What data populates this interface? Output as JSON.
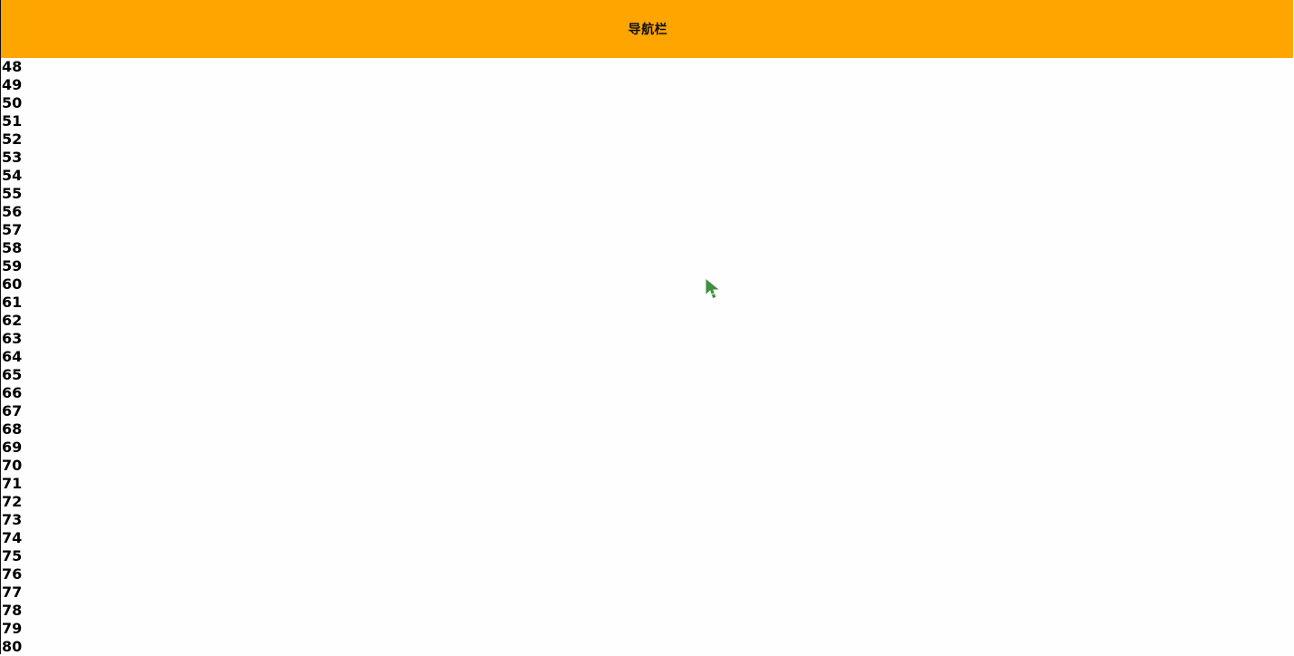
{
  "navbar": {
    "title": "导航栏",
    "background_color": "#ffa500"
  },
  "list": {
    "items": [
      "48",
      "49",
      "50",
      "51",
      "52",
      "53",
      "54",
      "55",
      "56",
      "57",
      "58",
      "59",
      "60",
      "61",
      "62",
      "63",
      "64",
      "65",
      "66",
      "67",
      "68",
      "69",
      "70",
      "71",
      "72",
      "73",
      "74",
      "75",
      "76",
      "77",
      "78",
      "79",
      "80"
    ]
  },
  "cursor": {
    "icon": "mouse-pointer-icon",
    "color": "#3f8f3f"
  }
}
